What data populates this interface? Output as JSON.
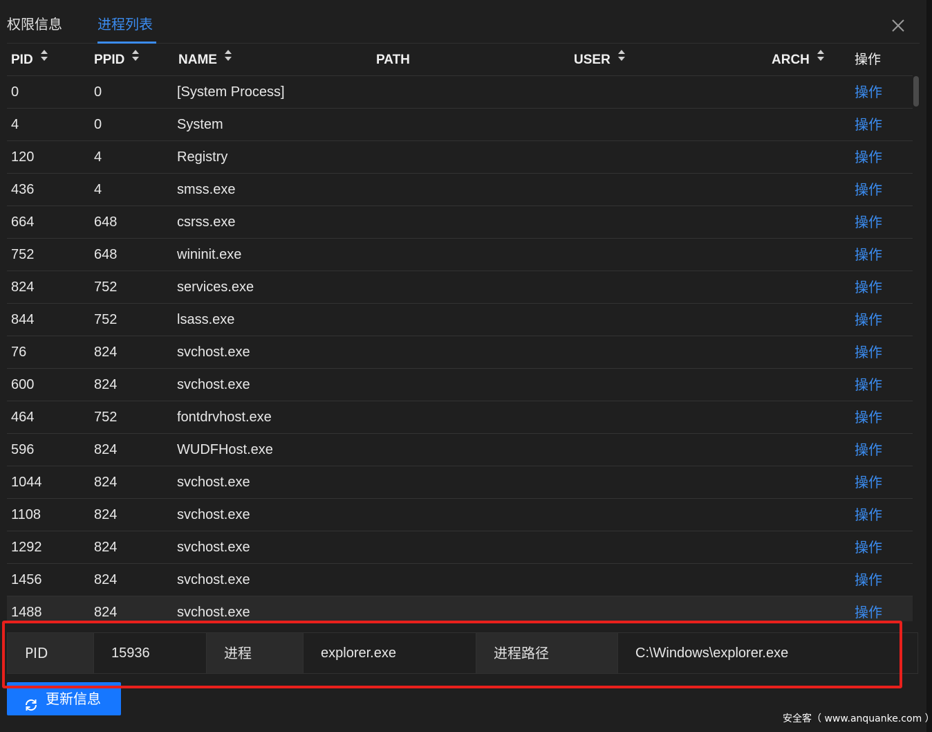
{
  "tabs": [
    {
      "label": "权限信息",
      "active": false
    },
    {
      "label": "进程列表",
      "active": true
    }
  ],
  "colors": {
    "accent": "#3b8cf0",
    "button": "#1677ff",
    "highlight": "#e8201c",
    "background": "#1f1f1f"
  },
  "table": {
    "columns": {
      "pid": "PID",
      "ppid": "PPID",
      "name": "NAME",
      "path": "PATH",
      "user": "USER",
      "arch": "ARCH",
      "op": "操作"
    },
    "rows": [
      {
        "pid": "0",
        "ppid": "0",
        "name": "[System Process]",
        "path": "",
        "user": "",
        "arch": "",
        "op": "操作"
      },
      {
        "pid": "4",
        "ppid": "0",
        "name": "System",
        "path": "",
        "user": "",
        "arch": "",
        "op": "操作"
      },
      {
        "pid": "120",
        "ppid": "4",
        "name": "Registry",
        "path": "",
        "user": "",
        "arch": "",
        "op": "操作"
      },
      {
        "pid": "436",
        "ppid": "4",
        "name": "smss.exe",
        "path": "",
        "user": "",
        "arch": "",
        "op": "操作"
      },
      {
        "pid": "664",
        "ppid": "648",
        "name": "csrss.exe",
        "path": "",
        "user": "",
        "arch": "",
        "op": "操作"
      },
      {
        "pid": "752",
        "ppid": "648",
        "name": "wininit.exe",
        "path": "",
        "user": "",
        "arch": "",
        "op": "操作"
      },
      {
        "pid": "824",
        "ppid": "752",
        "name": "services.exe",
        "path": "",
        "user": "",
        "arch": "",
        "op": "操作"
      },
      {
        "pid": "844",
        "ppid": "752",
        "name": "lsass.exe",
        "path": "",
        "user": "",
        "arch": "",
        "op": "操作"
      },
      {
        "pid": "76",
        "ppid": "824",
        "name": "svchost.exe",
        "path": "",
        "user": "",
        "arch": "",
        "op": "操作"
      },
      {
        "pid": "600",
        "ppid": "824",
        "name": "svchost.exe",
        "path": "",
        "user": "",
        "arch": "",
        "op": "操作"
      },
      {
        "pid": "464",
        "ppid": "752",
        "name": "fontdrvhost.exe",
        "path": "",
        "user": "",
        "arch": "",
        "op": "操作"
      },
      {
        "pid": "596",
        "ppid": "824",
        "name": "WUDFHost.exe",
        "path": "",
        "user": "",
        "arch": "",
        "op": "操作"
      },
      {
        "pid": "1044",
        "ppid": "824",
        "name": "svchost.exe",
        "path": "",
        "user": "",
        "arch": "",
        "op": "操作"
      },
      {
        "pid": "1108",
        "ppid": "824",
        "name": "svchost.exe",
        "path": "",
        "user": "",
        "arch": "",
        "op": "操作"
      },
      {
        "pid": "1292",
        "ppid": "824",
        "name": "svchost.exe",
        "path": "",
        "user": "",
        "arch": "",
        "op": "操作"
      },
      {
        "pid": "1456",
        "ppid": "824",
        "name": "svchost.exe",
        "path": "",
        "user": "",
        "arch": "",
        "op": "操作"
      },
      {
        "pid": "1488",
        "ppid": "824",
        "name": "svchost.exe",
        "path": "",
        "user": "",
        "arch": "",
        "op": "操作"
      }
    ]
  },
  "info": {
    "pid_label": "PID",
    "pid_value": "15936",
    "process_label": "进程",
    "process_value": "explorer.exe",
    "path_label": "进程路径",
    "path_value": "C:\\Windows\\explorer.exe"
  },
  "refresh_button": {
    "label": "更新信息",
    "icon": "sync-icon"
  },
  "close_icon": "close-icon",
  "sort_icon": "caret-sort-icon",
  "watermark": "安全客（ www.anquanke.com ）"
}
